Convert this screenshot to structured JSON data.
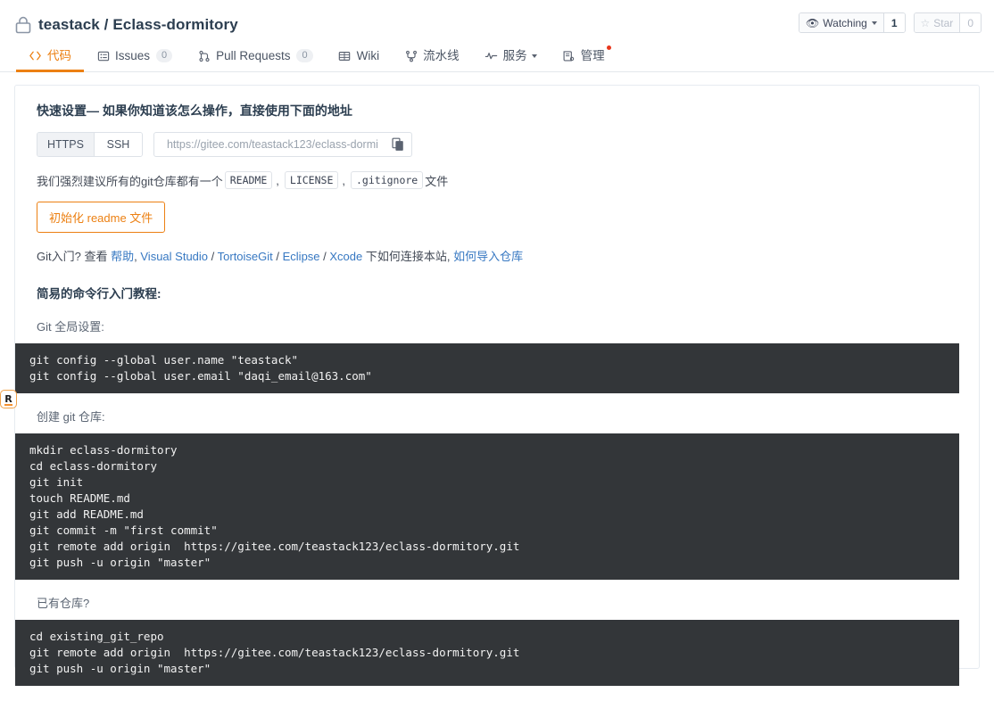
{
  "header": {
    "lock_icon": "lock-icon",
    "owner": "teastack",
    "separator": "/",
    "repo": "Eclass-dormitory",
    "full_title": "teastack / Eclass-dormitory",
    "watching_label": "Watching",
    "watching_count": "1",
    "star_label": "Star",
    "star_count": "0",
    "eye_icon": "eye-icon",
    "star_icon": "star-icon"
  },
  "tabs": [
    {
      "label": "代码",
      "icon": "code-icon",
      "badge": null,
      "active": true,
      "dropdown": false,
      "dot": false
    },
    {
      "label": "Issues",
      "icon": "issue-icon",
      "badge": "0",
      "active": false,
      "dropdown": false,
      "dot": false
    },
    {
      "label": "Pull Requests",
      "icon": "pull-request-icon",
      "badge": "0",
      "active": false,
      "dropdown": false,
      "dot": false
    },
    {
      "label": "Wiki",
      "icon": "wiki-icon",
      "badge": null,
      "active": false,
      "dropdown": false,
      "dot": false
    },
    {
      "label": "流水线",
      "icon": "pipeline-icon",
      "badge": null,
      "active": false,
      "dropdown": false,
      "dot": false
    },
    {
      "label": "服务",
      "icon": "service-icon",
      "badge": null,
      "active": false,
      "dropdown": true,
      "dot": false
    },
    {
      "label": "管理",
      "icon": "manage-icon",
      "badge": null,
      "active": false,
      "dropdown": false,
      "dot": true
    }
  ],
  "quick_setup": {
    "title": "快速设置— 如果你知道该怎么操作，直接使用下面的地址",
    "protocols": [
      {
        "label": "HTTPS",
        "selected": true
      },
      {
        "label": "SSH",
        "selected": false
      }
    ],
    "clone_url": "https://gitee.com/teastack123/eclass-dormi",
    "copy_icon": "copy-icon",
    "recommend_prefix": "我们强烈建议所有的git仓库都有一个",
    "recommend_files": [
      "README",
      "LICENSE",
      ".gitignore"
    ],
    "recommend_suffix": "文件",
    "readme_button": "初始化 readme 文件"
  },
  "links_line": {
    "prefix": "Git入门?",
    "view": "查看",
    "help": "帮助",
    "comma1": ",",
    "ide": [
      "Visual Studio",
      "TortoiseGit",
      "Eclipse",
      "Xcode"
    ],
    "middle": "下如何连接本站,",
    "import": "如何导入仓库"
  },
  "tutorial": {
    "title": "简易的命令行入门教程:",
    "blocks": [
      {
        "label": "Git 全局设置:",
        "code": "git config --global user.name \"teastack\"\ngit config --global user.email \"daqi_email@163.com\""
      },
      {
        "label": "创建 git 仓库:",
        "code": "mkdir eclass-dormitory\ncd eclass-dormitory\ngit init\ntouch README.md\ngit add README.md\ngit commit -m \"first commit\"\ngit remote add origin  https://gitee.com/teastack123/eclass-dormitory.git\ngit push -u origin \"master\""
      },
      {
        "label": "已有仓库?",
        "code": "cd existing_git_repo\ngit remote add origin  https://gitee.com/teastack123/eclass-dormitory.git\ngit push -u origin \"master\""
      }
    ]
  },
  "extension_badge": {
    "label": "R"
  },
  "colors": {
    "accent": "#ec8013",
    "link": "#3778c2",
    "title": "#2c3e50",
    "code_bg": "#333639",
    "dot": "#e8361c"
  }
}
